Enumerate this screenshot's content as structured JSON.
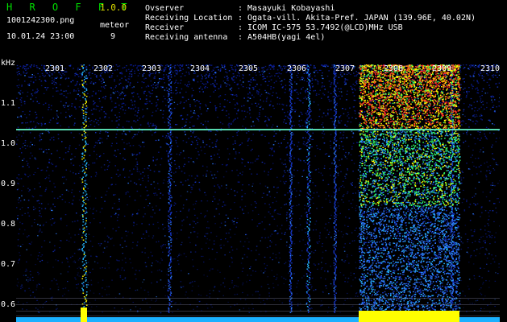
{
  "header": {
    "app_name": "H R O F F T",
    "version": "1.0.0",
    "filename": "1001242300.png",
    "datetime": "10.01.24 23:00",
    "meteor_label": "meteor",
    "meteor_count": "9"
  },
  "info": {
    "observer_label": "Ovserver",
    "observer": ": Masayuki Kobayashi",
    "location_label": "Receiving Location",
    "location": ": Ogata-vill. Akita-Pref. JAPAN (139.96E, 40.02N)",
    "receiver_label": "Receiver",
    "receiver": ": ICOM IC-575 53.7492(@LCD)MHz USB",
    "antenna_label": "Receiving antenna",
    "antenna": ": A504HB(yagi 4el)"
  },
  "axis": {
    "unit": "kHz",
    "y_ticks": [
      "1.1",
      "1.0",
      "0.9",
      "0.8",
      "0.7",
      "0.6"
    ],
    "x_ticks": [
      "2301",
      "2302",
      "2303",
      "2304",
      "2305",
      "2306",
      "2307",
      "2308",
      "2309",
      "2310"
    ]
  },
  "colors": {
    "background": "#000000",
    "title_green": "#00e000",
    "version_yellow": "#e0e000",
    "signal_line": "#66ffcc",
    "noise_low": "#0a1a8a",
    "noise_mid": "#2f7cff",
    "hot_green": "#33ff66",
    "hot_yellow": "#ffff00",
    "hot_red": "#ff2a2a"
  }
}
